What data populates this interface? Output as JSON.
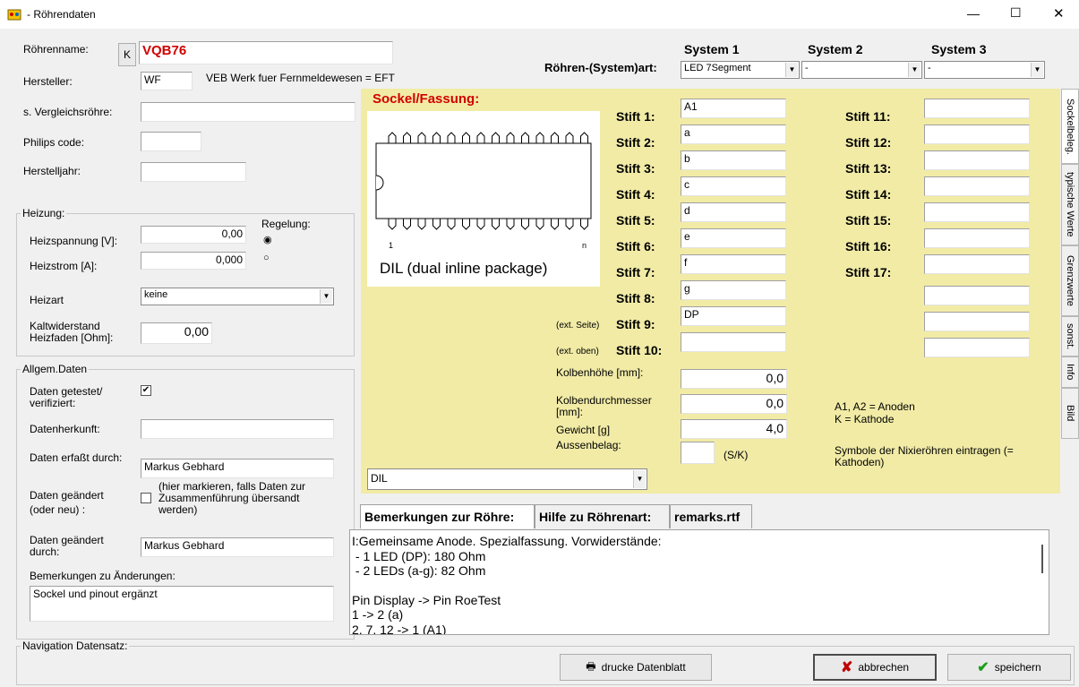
{
  "window": {
    "title": "- Röhrendaten",
    "minimize": "—",
    "maximize": "☐",
    "close": "✕"
  },
  "left": {
    "roehrenname_label": "Röhrenname:",
    "k_button": "K",
    "roehrenname_value": "VQB76",
    "hersteller_label": "Hersteller:",
    "hersteller_value": "WF",
    "hersteller_desc": "VEB Werk fuer Fernmeldewesen = EFT",
    "vergleich_label": "s. Vergleichsröhre:",
    "vergleich_value": "",
    "philips_label": "Philips code:",
    "philips_value": "",
    "herstelljahr_label": "Herstelljahr:",
    "herstelljahr_value": ""
  },
  "heizung": {
    "title": "Heizung:",
    "regelung_label": "Regelung:",
    "spannung_label": "Heizspannung [V]:",
    "spannung_value": "0,00",
    "strom_label": "Heizstrom [A]:",
    "strom_value": "0,000",
    "art_label": "Heizart",
    "art_value": "keine",
    "kalt_label": "Kaltwiderstand Heizfaden [Ohm]:",
    "kalt_value": "0,00"
  },
  "allgem": {
    "title": "Allgem.Daten",
    "getestet_label": "Daten getestet/ verifiziert:",
    "getestet_checked": "✔",
    "herkunft_label": "Datenherkunft:",
    "herkunft_value": "",
    "erfasst_label": "Daten erfaßt durch:",
    "erfasst_value": "Markus Gebhard",
    "geaendert_label": "Daten geändert (oder neu) :",
    "geaendert_hint": "(hier markieren, falls Daten zur Zusammenführung übersandt werden)",
    "geaendert_durch_label": "Daten geändert durch:",
    "geaendert_durch_value": "Markus Gebhard",
    "bem_label": "Bemerkungen zu Änderungen:",
    "bem_value": "Sockel und pinout ergänzt"
  },
  "navigation": {
    "title": "Navigation Datensatz:"
  },
  "system": {
    "art_label": "Röhren-(System)art:",
    "s1_label": "System 1",
    "s2_label": "System 2",
    "s3_label": "System 3",
    "s1_value": "LED 7Segment",
    "s2_value": "-",
    "s3_value": "-"
  },
  "sockel": {
    "title": "Sockel/Fassung:",
    "dil_caption": "DIL (dual inline package)",
    "pin1": "1",
    "pinn": "n",
    "ext_seite": "(ext. Seite)",
    "ext_oben": "(ext. oben)",
    "stifte_left": [
      {
        "label": "Stift 1:",
        "value": "A1"
      },
      {
        "label": "Stift 2:",
        "value": "a"
      },
      {
        "label": "Stift 3:",
        "value": "b"
      },
      {
        "label": "Stift 4:",
        "value": "c"
      },
      {
        "label": "Stift 5:",
        "value": "d"
      },
      {
        "label": "Stift 6:",
        "value": "e"
      },
      {
        "label": "Stift 7:",
        "value": "f"
      },
      {
        "label": "Stift 8:",
        "value": "g"
      },
      {
        "label": "Stift 9:",
        "value": "DP"
      },
      {
        "label": "Stift 10:",
        "value": ""
      }
    ],
    "stifte_right": [
      {
        "label": "Stift 11:",
        "value": ""
      },
      {
        "label": "Stift 12:",
        "value": ""
      },
      {
        "label": "Stift 13:",
        "value": ""
      },
      {
        "label": "Stift 14:",
        "value": ""
      },
      {
        "label": "Stift 15:",
        "value": ""
      },
      {
        "label": "Stift 16:",
        "value": ""
      },
      {
        "label": "Stift 17:",
        "value": ""
      }
    ],
    "kolbenhoehe_label": "Kolbenhöhe [mm]:",
    "kolbenhoehe_value": "0,0",
    "kolbendm_label": "Kolbendurchmesser [mm]:",
    "kolbendm_value": "0,0",
    "gewicht_label": "Gewicht [g]",
    "gewicht_value": "4,0",
    "aussenbelag_label": "Aussenbelag:",
    "aussenbelag_value": "",
    "sk_label": "(S/K)",
    "note1": "A1, A2 = Anoden",
    "note2": "K = Kathode",
    "note3": "Symbole der Nixieröhren eintragen (= Kathoden)",
    "sockel_select": "DIL"
  },
  "sidetabs": [
    "Sockelbeleg.",
    "typische Werte",
    "Grenzwerte",
    "sonst.",
    "Info",
    "Bild"
  ],
  "bottom_tabs": [
    "Bemerkungen zur Röhre:",
    "Hilfe zu Röhrenart:",
    "remarks.rtf"
  ],
  "remarks_lines": [
    "I:Gemeinsame Anode. Spezialfassung. Vorwiderstände:",
    " - 1 LED (DP): 180 Ohm",
    " - 2 LEDs (a-g): 82 Ohm",
    "",
    "Pin Display -> Pin RoeTest",
    "1 -> 2 (a)",
    "2, 7, 12 -> 1 (A1)"
  ],
  "buttons": {
    "print": "drucke Datenblatt",
    "cancel": "abbrechen",
    "save": "speichern"
  },
  "colors": {
    "panel_yellow": "#f1eba6",
    "title_red": "#d10000"
  }
}
